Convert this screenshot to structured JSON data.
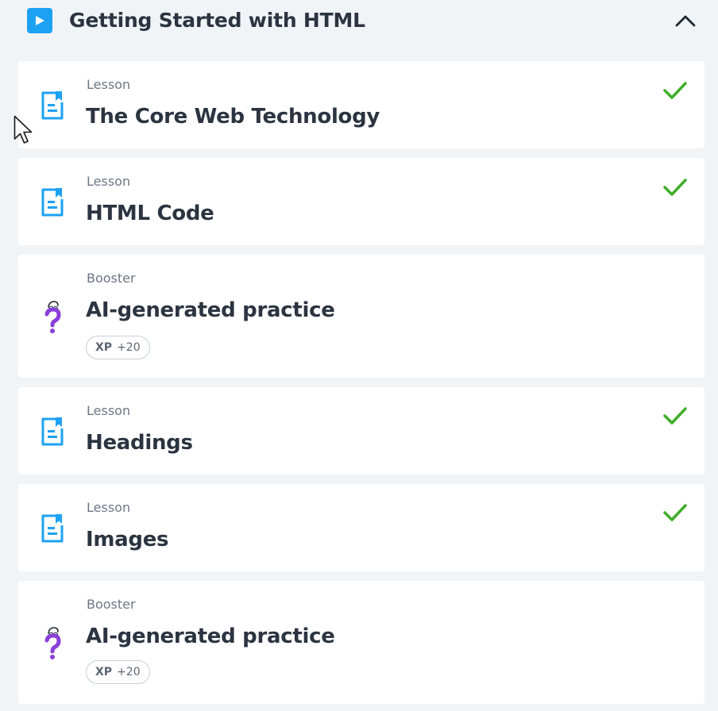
{
  "section": {
    "title": "Getting Started with HTML"
  },
  "colors": {
    "accent": "#1da1f2",
    "check": "#3fae2a",
    "booster": "#8a3fd9",
    "background": "#f1f4f7"
  },
  "items": [
    {
      "type": "Lesson",
      "title": "The Core Web Technology",
      "completed": true,
      "icon": "lesson-icon"
    },
    {
      "type": "Lesson",
      "title": "HTML Code",
      "completed": true,
      "icon": "lesson-icon"
    },
    {
      "type": "Booster",
      "title": "AI-generated practice",
      "completed": false,
      "icon": "question-mark-icon",
      "xp_label": "XP",
      "xp_value": "+20"
    },
    {
      "type": "Lesson",
      "title": "Headings",
      "completed": true,
      "icon": "lesson-icon"
    },
    {
      "type": "Lesson",
      "title": "Images",
      "completed": true,
      "icon": "lesson-icon"
    },
    {
      "type": "Booster",
      "title": "AI-generated practice",
      "completed": false,
      "icon": "question-mark-icon",
      "xp_label": "XP",
      "xp_value": "+20"
    }
  ]
}
